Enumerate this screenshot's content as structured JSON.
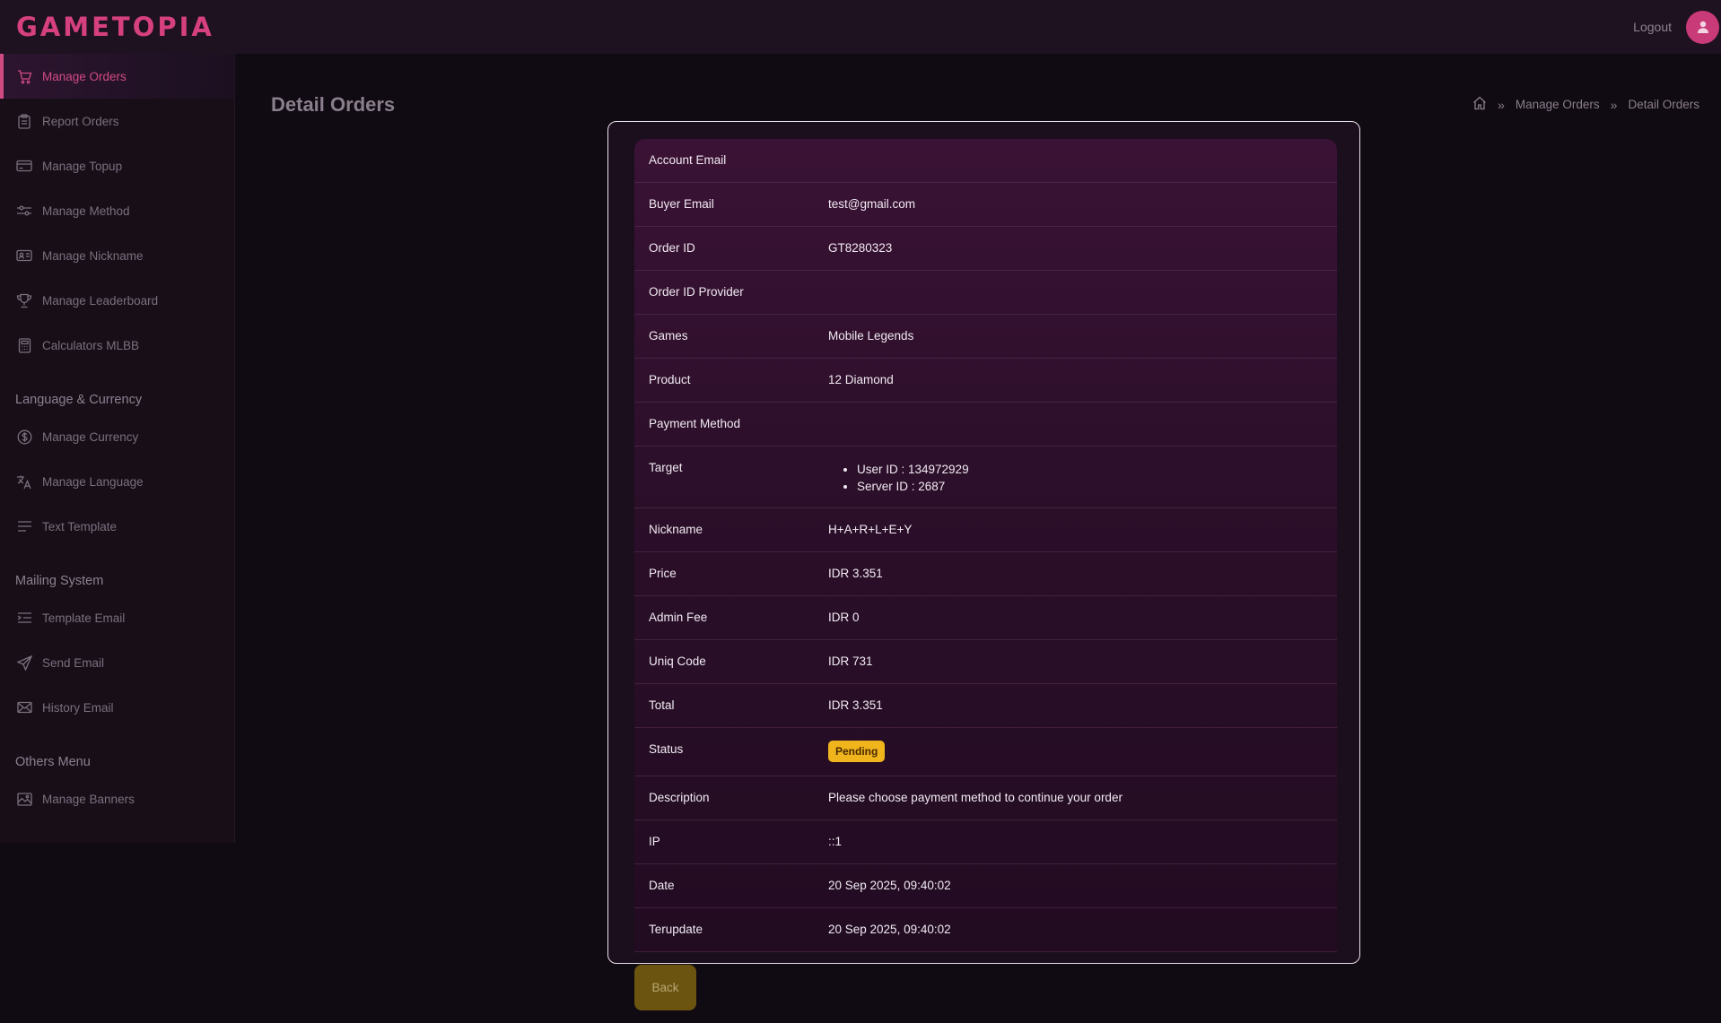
{
  "app": {
    "logo": "GAMETOPIA",
    "logout_label": "Logout"
  },
  "colors": {
    "accent": "#d24a84",
    "status_pending": "#f0b41d",
    "back_button": "#6b5410"
  },
  "sidebar": {
    "items": [
      {
        "label": "Manage Orders",
        "icon": "cart-icon",
        "active": true
      },
      {
        "label": "Report Orders",
        "icon": "clipboard-icon"
      },
      {
        "label": "Manage Topup",
        "icon": "card-icon"
      },
      {
        "label": "Manage Method",
        "icon": "sliders-icon"
      },
      {
        "label": "Manage Nickname",
        "icon": "id-card-icon"
      },
      {
        "label": "Manage Leaderboard",
        "icon": "trophy-icon"
      },
      {
        "label": "Calculators MLBB",
        "icon": "calculator-icon"
      }
    ],
    "group_language": "Language & Currency",
    "items_language": [
      {
        "label": "Manage Currency",
        "icon": "currency-icon"
      },
      {
        "label": "Manage Language",
        "icon": "translate-icon"
      },
      {
        "label": "Text Template",
        "icon": "text-lines-icon"
      }
    ],
    "group_mailing": "Mailing System",
    "items_mailing": [
      {
        "label": "Template Email",
        "icon": "list-indent-icon"
      },
      {
        "label": "Send Email",
        "icon": "send-icon"
      },
      {
        "label": "History Email",
        "icon": "mail-icon"
      }
    ],
    "group_others": "Others Menu",
    "items_others": [
      {
        "label": "Manage Banners",
        "icon": "image-icon"
      }
    ]
  },
  "main": {
    "title": "Detail Orders",
    "breadcrumb": {
      "home_icon": "home-icon",
      "parent": "Manage Orders",
      "current": "Detail Orders"
    }
  },
  "details": {
    "account_email": {
      "label": "Account Email",
      "value": ""
    },
    "buyer_email": {
      "label": "Buyer Email",
      "value": "test@gmail.com"
    },
    "order_id": {
      "label": "Order ID",
      "value": "GT8280323"
    },
    "order_id_provider": {
      "label": "Order ID Provider",
      "value": ""
    },
    "games": {
      "label": "Games",
      "value": "Mobile Legends"
    },
    "product": {
      "label": "Product",
      "value": "12 Diamond"
    },
    "payment_method": {
      "label": "Payment Method",
      "value": ""
    },
    "target": {
      "label": "Target",
      "user_id": "User ID : 134972929",
      "server_id": "Server ID : 2687"
    },
    "nickname": {
      "label": "Nickname",
      "value": "H+A+R+L+E+Y"
    },
    "price": {
      "label": "Price",
      "value": "IDR 3.351"
    },
    "admin_fee": {
      "label": "Admin Fee",
      "value": "IDR 0"
    },
    "uniq_code": {
      "label": "Uniq Code",
      "value": "IDR 731"
    },
    "total": {
      "label": "Total",
      "value": "IDR 3.351"
    },
    "status": {
      "label": "Status",
      "value": "Pending"
    },
    "description": {
      "label": "Description",
      "value": "Please choose payment method to continue your order"
    },
    "ip": {
      "label": "IP",
      "value": "::1"
    },
    "date": {
      "label": "Date",
      "value": "20 Sep 2025, 09:40:02"
    },
    "terupdate": {
      "label": "Terupdate",
      "value": "20 Sep 2025, 09:40:02"
    }
  },
  "back_label": "Back"
}
